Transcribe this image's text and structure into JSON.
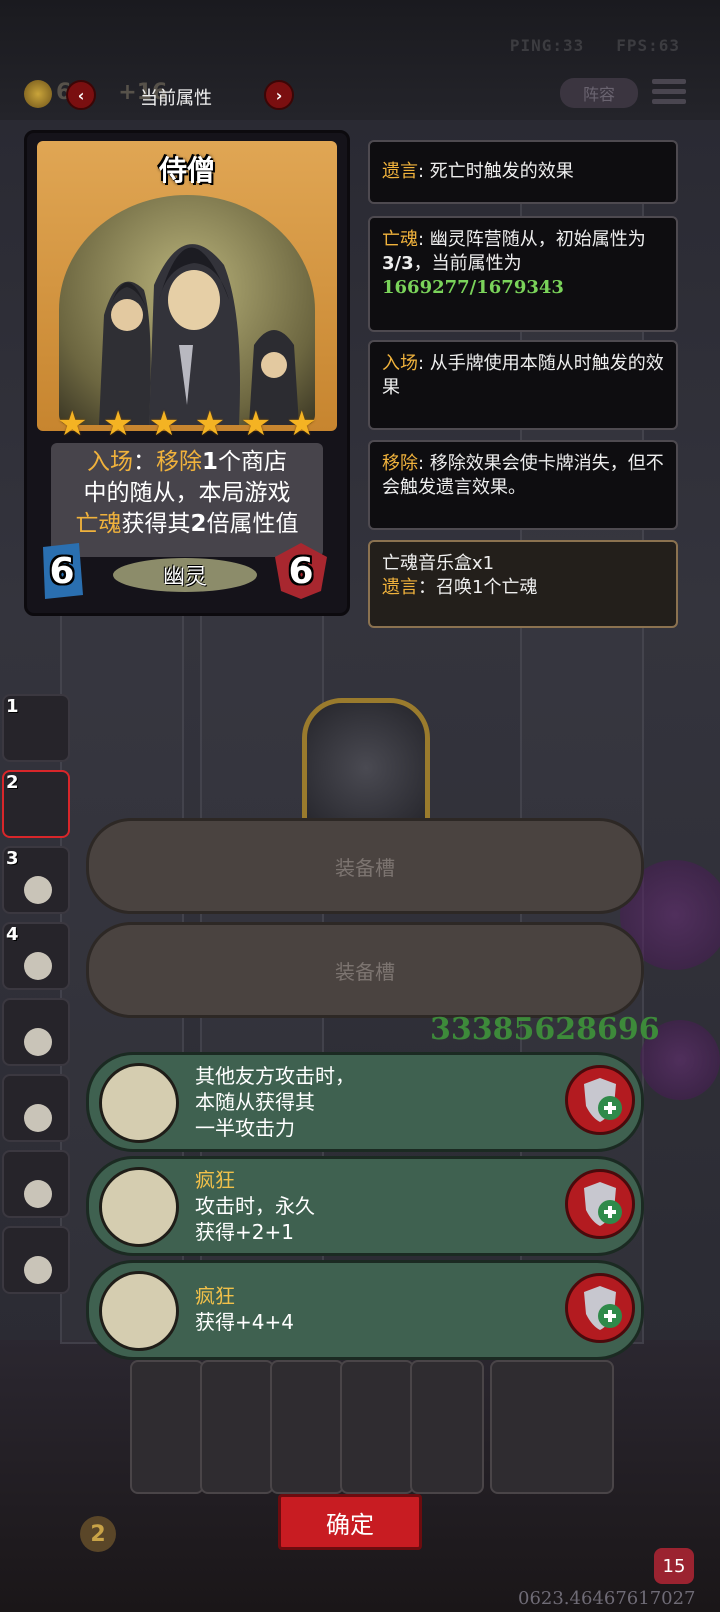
{
  "hud": {
    "ping": "PING:33",
    "fps": "FPS:63",
    "gold_count": "6",
    "gold_income": "+16",
    "title": "当前属性",
    "lineup_label": "阵容"
  },
  "card": {
    "name": "侍僧",
    "stars": 6,
    "desc_line1_kw1": "入场",
    "desc_line1_sep": "：",
    "desc_line1_kw2": "移除",
    "desc_line1_num": "1",
    "desc_line1_rest": "个商店",
    "desc_line2": "中的随从，本局游戏",
    "desc_line3_kw": "亡魂",
    "desc_line3_a": "获得其",
    "desc_line3_num": "2",
    "desc_line3_b": "倍属性值",
    "attack": "6",
    "health": "6",
    "tribe": "幽灵"
  },
  "tooltips": {
    "deathrattle_kw": "遗言",
    "deathrattle_text": ": 死亡时触发的效果",
    "spirit_kw": "亡魂",
    "spirit_text": ": 幽灵阵营随从，初始属性为",
    "spirit_base": "3/3",
    "spirit_text2": "，当前属性为",
    "spirit_current": "1669277/1679343",
    "battlecry_kw": "入场",
    "battlecry_text": ": 从手牌使用本随从时触发的效果",
    "remove_kw": "移除",
    "remove_text": ": 移除效果会使卡牌消失，但不会触发遗言效果。",
    "item_name": "亡魂音乐盒x1",
    "item_kw": "遗言",
    "item_text": "：召唤1个亡魂"
  },
  "roster": [
    "1",
    "2",
    "3",
    "4"
  ],
  "equip_slots": [
    "装备槽",
    "装备槽"
  ],
  "board_score": "33385628696",
  "skills": [
    {
      "kw": "",
      "lines": [
        "其他友方攻击时，",
        "本随从获得其",
        "一半攻击力"
      ]
    },
    {
      "kw": "疯狂",
      "lines": [
        "攻击时，永久",
        "获得+2+1"
      ]
    },
    {
      "kw": "疯狂",
      "lines": [
        "获得+4+4"
      ]
    }
  ],
  "confirm_label": "确定",
  "player_level": "2",
  "player_hp": "15",
  "bottom_number": "0623.46467617027"
}
